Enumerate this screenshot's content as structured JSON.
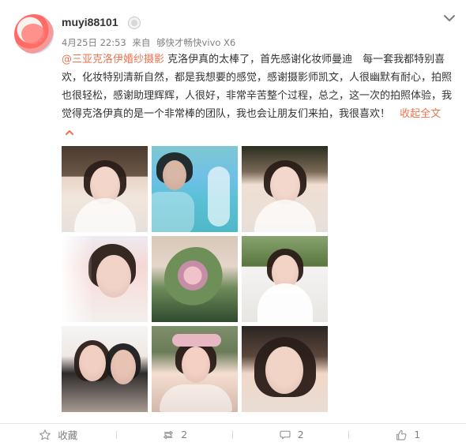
{
  "post": {
    "username": "muyi88101",
    "meta": {
      "date": "4月25日 22:53",
      "from_label": "来自",
      "source": "够快才畅快vivo X6"
    },
    "content": {
      "mention": "@三亚克洛伊婚纱摄影",
      "text": "克洛伊真的太棒了，首先感谢化妆师曼迪　每一套我都特别喜欢，化妆特别清新自然，都是我想要的感觉，感谢摄影师凯文，人很幽默有耐心，拍照也很轻松，感谢助理辉辉，人很好，非常辛苦整个过程，总之，这一次的拍照体验，我觉得克洛伊真的是一个非常棒的团队，我也会让朋友们来拍，我很喜欢！",
      "collapse_label": "收起全文"
    }
  },
  "actions": {
    "favorite": {
      "label": "收藏"
    },
    "repost": {
      "count": "2"
    },
    "comment": {
      "count": "2"
    },
    "like": {
      "count": "1"
    }
  },
  "icons": {
    "avatar": "avatar",
    "user_badge": "user-badge-icon",
    "menu": "chevron-down-icon",
    "favorite": "star-icon",
    "repost": "repost-icon",
    "comment": "comment-icon",
    "like": "thumbs-up-icon",
    "collapse": "chevron-up-icon"
  },
  "colors": {
    "accent": "#eb7350",
    "text": "#333333",
    "meta": "#808080",
    "divider": "#e6e6e6"
  }
}
